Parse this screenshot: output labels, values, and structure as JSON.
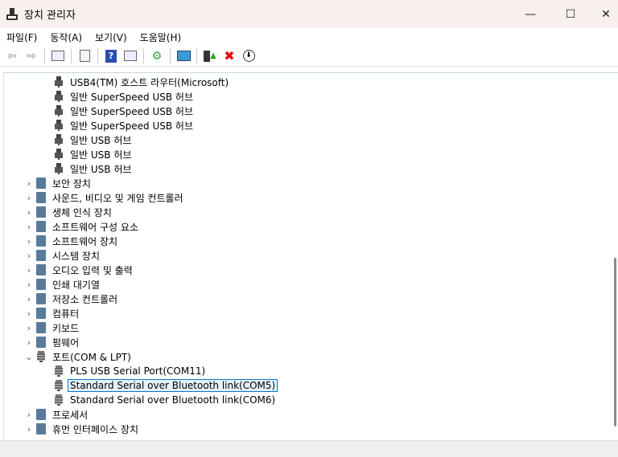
{
  "window": {
    "title": "장치 관리자",
    "minimize": "—",
    "maximize": "☐",
    "close": "✕"
  },
  "menu": [
    "파일(F)",
    "동작(A)",
    "보기(V)",
    "도움말(H)"
  ],
  "toolbar": [
    "back-icon",
    "forward-icon",
    "show-hide-tree-icon",
    "properties-icon",
    "help-icon",
    "action-pane-icon",
    "update-driver-icon",
    "scan-hardware-icon",
    "enable-device-icon",
    "uninstall-icon",
    "disable-icon"
  ],
  "usb_children": [
    "USB4(TM) 호스트 라우터(Microsoft)",
    "일반 SuperSpeed USB 허브",
    "일반 SuperSpeed USB 허브",
    "일반 SuperSpeed USB 허브",
    "일반 USB 허브",
    "일반 USB 허브",
    "일반 USB 허브"
  ],
  "categories_before": [
    "보안 장치",
    "사운드, 비디오 및 게임 컨트롤러",
    "생체 인식 장치",
    "소프트웨어 구성 요소",
    "소프트웨어 장치",
    "시스템 장치",
    "오디오 입력 및 출력",
    "인쇄 대기열",
    "저장소 컨트롤러",
    "컴퓨터",
    "키보드",
    "펌웨어"
  ],
  "ports": {
    "label": "포트(COM & LPT)",
    "children": [
      "PLS USB Serial Port(COM11)",
      "Standard Serial over Bluetooth link(COM5)",
      "Standard Serial over Bluetooth link(COM6)"
    ],
    "selected": 1
  },
  "categories_after": [
    "프로세서",
    "휴먼 인터페이스 장치"
  ]
}
